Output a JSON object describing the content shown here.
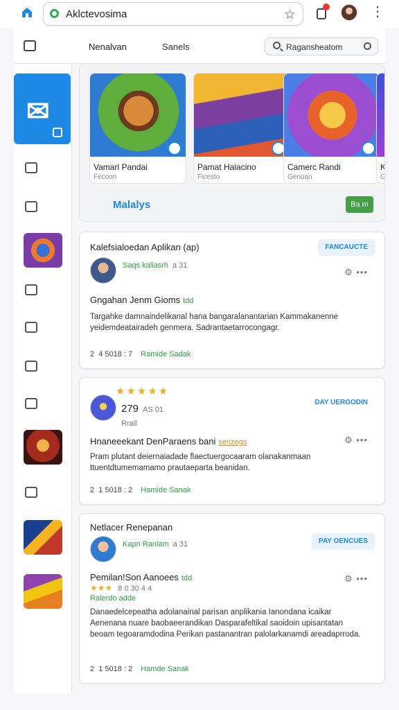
{
  "browser": {
    "url_text": "Aklctevosima"
  },
  "header": {
    "tabs": [
      "Nenalvan",
      "Sanels"
    ],
    "search_text": "Ragansheatom"
  },
  "carousel": {
    "games": [
      {
        "title": "Vamarl Pandai",
        "subtitle": "Fecoon"
      },
      {
        "title": "Pamat Halacino",
        "subtitle": "Ficesto"
      },
      {
        "title": "Camerc Randi",
        "subtitle": "Genoan"
      },
      {
        "title": "K",
        "subtitle": "G"
      }
    ],
    "more_label": "Malalys",
    "button_label": "Ba m"
  },
  "reviews": [
    {
      "card_title": "Kalefsialoedan Aplikan (ap)",
      "pill": "FANCAUCTE",
      "user_name": "Saqs kaliasrh",
      "user_num": "a 31",
      "review_title": "Gngahan Jenm Gioms",
      "review_tag": "tdd",
      "body": "Targahke damnaindelikanal hana bangaralanantarian Kammakanenne yeidemdeatairadeh genmera. Sadrantaetarrocongagr.",
      "foot_num": "2",
      "foot_date": "4 5018 : 7",
      "foot_link": "Ramide Sadak"
    },
    {
      "pill": "DAY UERGODIN",
      "stars": "★★★★★",
      "rating": "279",
      "rating_num": "AS 01",
      "user_sub": "Rrall",
      "review_title": "Hnaneeekant DenParaens bani",
      "review_tag": "senzegs",
      "body": "Pram plutant deiernaiadade flaectuergocaaram olanakanmaan ttuentdtumemamamo prautaeparta beanidan.",
      "foot_num": "2",
      "foot_date": "1 5018 : 2",
      "foot_link": "Hamide Sanak"
    },
    {
      "card_title": "Netlacer Renepanan",
      "pill": "PAY OENCUES",
      "user_name": "Kapn Ranlam",
      "user_num": "a 31",
      "review_title": "Pemilan!Son Aanoees",
      "review_tag": "tdd",
      "stars": "★★★",
      "stars_num": "8 0 30 4 4",
      "green_sub": "Ralerdo adde",
      "body": "Danaedelcepeatha adolanainal parisan anplikania Ianondana icaikar Aenenana nuare baobaeerandikan Dasparafeltikal saoidoin upisantatan beoam tegoaramdodina Perikan pastanantran palolarkanamdi areadaprroda.",
      "foot_num": "2",
      "foot_date": "1 5018 : 2",
      "foot_link": "Hamde Sanak"
    }
  ],
  "colors": {
    "accent": "#1e88e5",
    "green": "#2e9f45",
    "star": "#f2b01e"
  }
}
